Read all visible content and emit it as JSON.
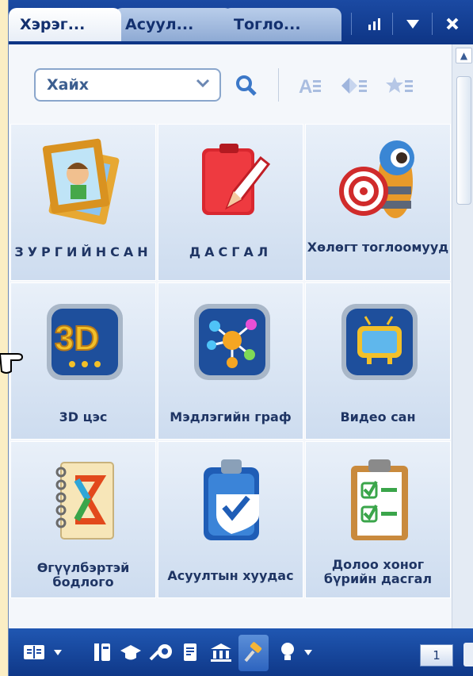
{
  "tabs": [
    {
      "label": "Хэрэг...",
      "active": true
    },
    {
      "label": "Асуул...",
      "active": false
    },
    {
      "label": "Тогло...",
      "active": false
    }
  ],
  "tab_icons": [
    "bar-chart-icon",
    "dropdown-arrow-icon",
    "close-icon"
  ],
  "search": {
    "selected": "Хайх"
  },
  "grid": [
    {
      "label": "ЗУРГИЙНСАН",
      "icon": "picture-frame-icon"
    },
    {
      "label": "ДАСГАЛ",
      "icon": "red-notebook-pencil-icon"
    },
    {
      "label": "Хөлөгт тоглоомууд",
      "icon": "target-camera-icon"
    },
    {
      "label": "3D цэс",
      "icon": "3d-icon"
    },
    {
      "label": "Мэдлэгийн граф",
      "icon": "knowledge-graph-icon"
    },
    {
      "label": "Видео сан",
      "icon": "tv-icon"
    },
    {
      "label": "Өгүүлбэртэй бодлого",
      "icon": "sigma-notebook-icon"
    },
    {
      "label": "Асуултын хуудас",
      "icon": "clipboard-check-icon"
    },
    {
      "label": "Долоо хоног бүрийн дасгал",
      "icon": "checklist-clipboard-icon"
    }
  ],
  "bottom": {
    "page": "1"
  },
  "colors": {
    "tabbar": "#1b4aa3",
    "accent": "#1f3564",
    "page_bg": "#fbeec4"
  }
}
